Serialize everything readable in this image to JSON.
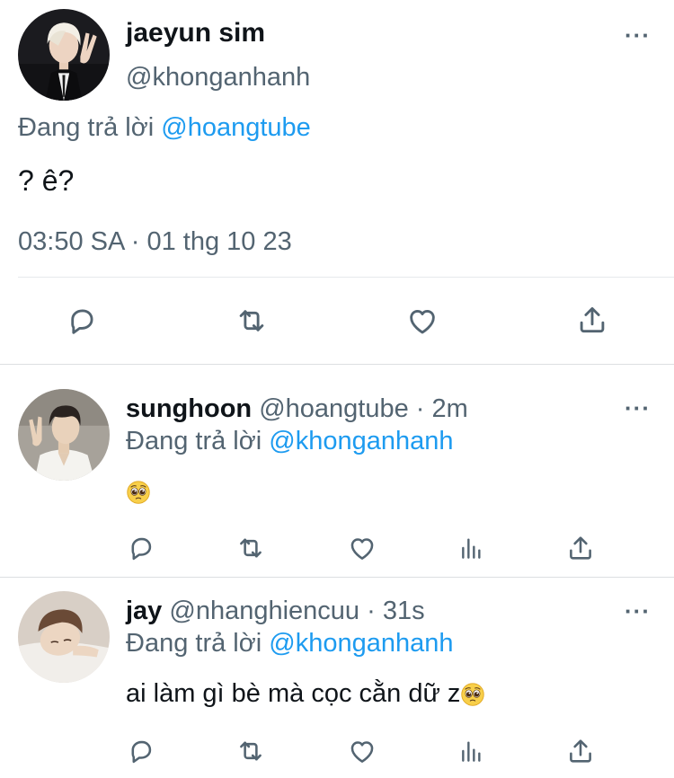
{
  "main_tweet": {
    "name": "jaeyun sim",
    "handle": "@khonganhanh",
    "replying_prefix": "Đang trả lời ",
    "replying_to": "@hoangtube",
    "text": "? ê?",
    "timestamp": "03:50 SA · 01 thg 10 23",
    "more_icon": "···",
    "actions": [
      "reply-icon",
      "retweet-icon",
      "like-icon",
      "share-icon"
    ]
  },
  "replies": [
    {
      "name": "sunghoon",
      "handle": "@hoangtube",
      "time": "· 2m",
      "replying_prefix": "Đang trả lời ",
      "replying_to": "@khonganhanh",
      "text": "",
      "emoji": "pleading-face",
      "more_icon": "···",
      "actions": [
        "reply-icon",
        "retweet-icon",
        "like-icon",
        "analytics-icon",
        "share-icon"
      ]
    },
    {
      "name": "jay",
      "handle": "@nhanghiencuu",
      "time": "· 31s",
      "replying_prefix": "Đang trả lời ",
      "replying_to": "@khonganhanh",
      "text": "ai làm gì bè mà cọc cằn dữ z",
      "emoji": "pleading-face",
      "more_icon": "···",
      "actions": [
        "reply-icon",
        "retweet-icon",
        "like-icon",
        "analytics-icon",
        "share-icon"
      ]
    }
  ],
  "colors": {
    "text": "#0f1419",
    "secondary": "#536471",
    "link": "#1d9bf0",
    "divider": "#e6e9ec"
  }
}
